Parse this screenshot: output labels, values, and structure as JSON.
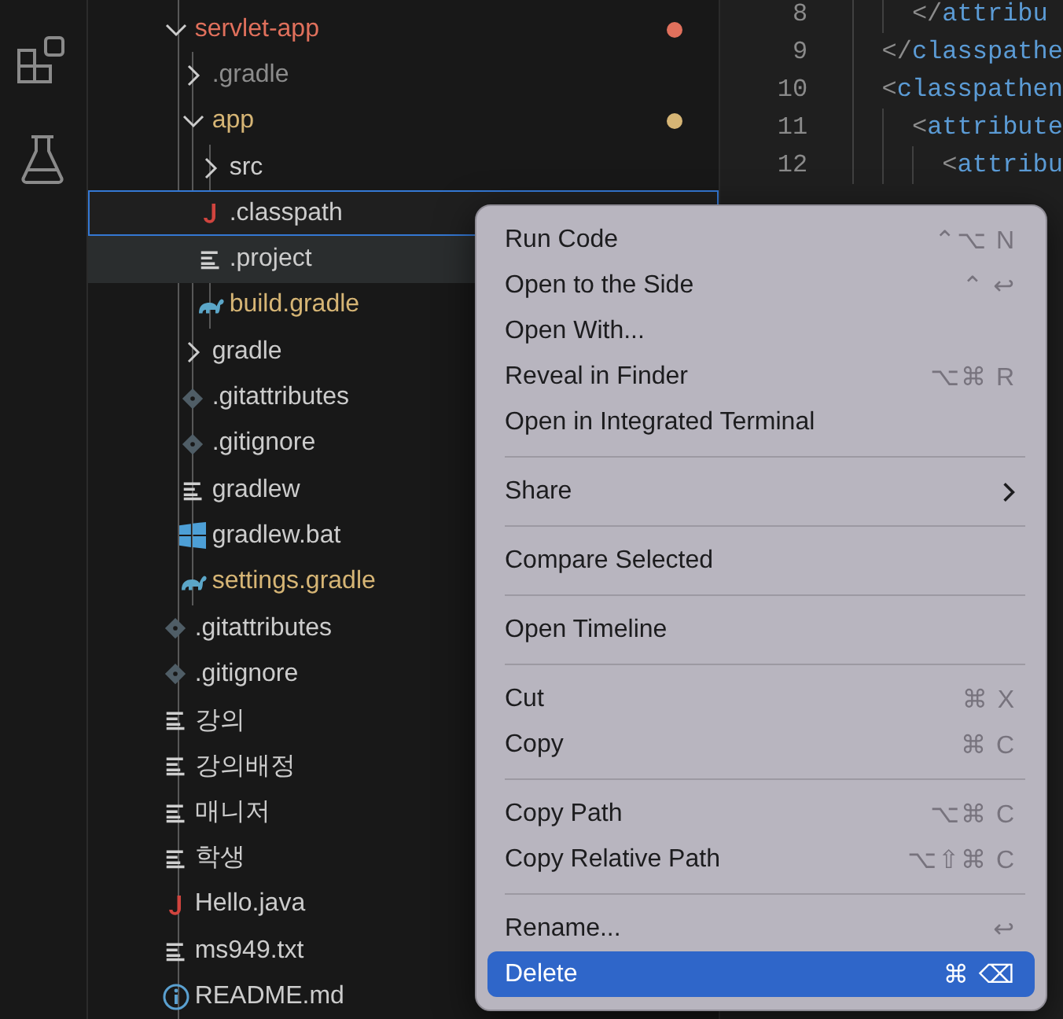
{
  "activity_bar": {
    "items": [
      {
        "kind": "extensions"
      },
      {
        "kind": "testing"
      }
    ]
  },
  "explorer": {
    "tree": [
      {
        "label": "servlet-app",
        "kind": "folder",
        "expanded": true,
        "selected": false,
        "hovered": false,
        "color": "#e0705c",
        "dot": true,
        "children": [
          {
            "label": ".gradle",
            "kind": "folder",
            "expanded": false,
            "selected": false,
            "hovered": false,
            "dimmed": true
          },
          {
            "label": "app",
            "kind": "folder",
            "expanded": true,
            "selected": false,
            "hovered": false,
            "color": "#d6b575",
            "dot": true,
            "children": [
              {
                "label": "src",
                "kind": "folder",
                "expanded": false,
                "selected": false,
                "hovered": false
              },
              {
                "label": ".classpath",
                "kind": "java",
                "selected": true,
                "hovered": false
              },
              {
                "label": ".project",
                "kind": "text",
                "selected": false,
                "hovered": true
              },
              {
                "label": "build.gradle",
                "kind": "gradle",
                "selected": false,
                "hovered": false,
                "color": "#d6b575"
              }
            ]
          },
          {
            "label": "gradle",
            "kind": "folder",
            "expanded": false,
            "selected": false,
            "hovered": false
          },
          {
            "label": ".gitattributes",
            "kind": "git",
            "selected": false,
            "hovered": false
          },
          {
            "label": ".gitignore",
            "kind": "git",
            "selected": false,
            "hovered": false
          },
          {
            "label": "gradlew",
            "kind": "text",
            "selected": false,
            "hovered": false
          },
          {
            "label": "gradlew.bat",
            "kind": "windows",
            "selected": false,
            "hovered": false
          },
          {
            "label": "settings.gradle",
            "kind": "gradle",
            "selected": false,
            "hovered": false,
            "color": "#d6b575"
          }
        ]
      },
      {
        "label": ".gitattributes",
        "kind": "git",
        "selected": false,
        "hovered": false
      },
      {
        "label": ".gitignore",
        "kind": "git",
        "selected": false,
        "hovered": false
      },
      {
        "label": "강의",
        "kind": "text",
        "selected": false,
        "hovered": false
      },
      {
        "label": "강의배정",
        "kind": "text",
        "selected": false,
        "hovered": false
      },
      {
        "label": "매니저",
        "kind": "text",
        "selected": false,
        "hovered": false
      },
      {
        "label": "학생",
        "kind": "text",
        "selected": false,
        "hovered": false
      },
      {
        "label": "Hello.java",
        "kind": "java",
        "selected": false,
        "hovered": false
      },
      {
        "label": "ms949.txt",
        "kind": "text",
        "selected": false,
        "hovered": false
      },
      {
        "label": "README.md",
        "kind": "info",
        "selected": false,
        "hovered": false
      }
    ]
  },
  "editor": {
    "lines": [
      {
        "number": "8",
        "text": "    </attribu"
      },
      {
        "number": "9",
        "text": "  </classpathe"
      },
      {
        "number": "10",
        "text": "  <classpathen"
      },
      {
        "number": "11",
        "text": "    <attribute"
      },
      {
        "number": "12",
        "text": "      <attribu"
      }
    ]
  },
  "context_menu": {
    "items": [
      {
        "kind": "item",
        "label": "Run Code",
        "shortcut": "⌃⌥ N",
        "selected": false
      },
      {
        "kind": "item",
        "label": "Open to the Side",
        "shortcut": "⌃ ↩",
        "selected": false
      },
      {
        "kind": "item",
        "label": "Open With...",
        "selected": false
      },
      {
        "kind": "item",
        "label": "Reveal in Finder",
        "shortcut": "⌥⌘ R",
        "selected": false
      },
      {
        "kind": "item",
        "label": "Open in Integrated Terminal",
        "selected": false
      },
      {
        "kind": "separator"
      },
      {
        "kind": "submenu",
        "label": "Share",
        "selected": false
      },
      {
        "kind": "separator"
      },
      {
        "kind": "item",
        "label": "Compare Selected",
        "selected": false
      },
      {
        "kind": "separator"
      },
      {
        "kind": "item",
        "label": "Open Timeline",
        "selected": false
      },
      {
        "kind": "separator"
      },
      {
        "kind": "item",
        "label": "Cut",
        "shortcut": "⌘ X",
        "selected": false
      },
      {
        "kind": "item",
        "label": "Copy",
        "shortcut": "⌘ C",
        "selected": false
      },
      {
        "kind": "separator"
      },
      {
        "kind": "item",
        "label": "Copy Path",
        "shortcut": "⌥⌘ C",
        "selected": false
      },
      {
        "kind": "item",
        "label": "Copy Relative Path",
        "shortcut": "⌥⇧⌘ C",
        "selected": false
      },
      {
        "kind": "separator"
      },
      {
        "kind": "item",
        "label": "Rename...",
        "shortcut": "↩",
        "selected": false
      },
      {
        "kind": "item",
        "label": "Delete",
        "shortcut": "⌘ ⌫",
        "selected": true
      }
    ]
  }
}
